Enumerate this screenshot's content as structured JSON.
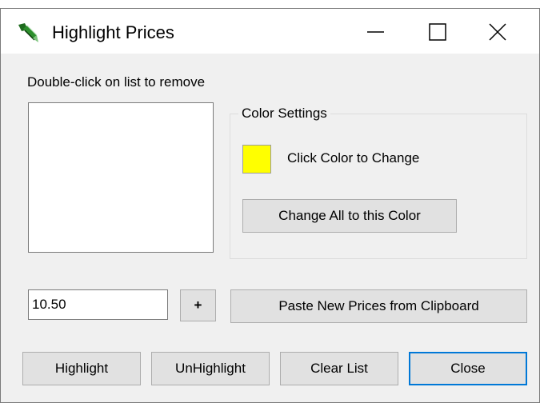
{
  "window": {
    "title": "Highlight Prices"
  },
  "hint": "Double-click on list to remove",
  "price_list": [],
  "color_settings": {
    "group_label": "Color Settings",
    "swatch_color": "#ffff00",
    "swatch_label": "Click Color to Change",
    "change_all_label": "Change All to this Color"
  },
  "input": {
    "value": "10.50",
    "add_label": "+",
    "paste_label": "Paste New Prices from Clipboard"
  },
  "actions": {
    "highlight_label": "Highlight",
    "unhighlight_label": "UnHighlight",
    "clear_label": "Clear List",
    "close_label": "Close"
  },
  "icons": {
    "app": "highlighter-icon",
    "minimize": "minimize-icon",
    "maximize": "maximize-icon",
    "close": "close-icon"
  }
}
